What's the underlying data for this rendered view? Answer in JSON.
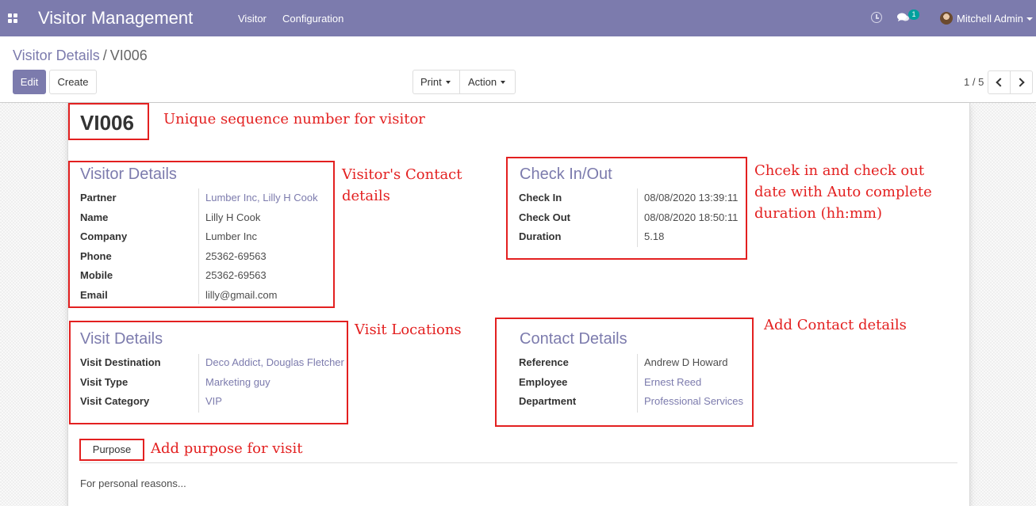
{
  "navbar": {
    "app_title": "Visitor Management",
    "menu": [
      "Visitor",
      "Configuration"
    ],
    "activity_icon": "clock-icon",
    "messages_icon": "chat-bubbles-icon",
    "messages_count": "1",
    "user_name": "Mitchell Admin"
  },
  "breadcrumb": {
    "parent": "Visitor Details",
    "separator": "/",
    "current": "VI006"
  },
  "toolbar": {
    "edit": "Edit",
    "create": "Create",
    "print": "Print",
    "action": "Action"
  },
  "pager": {
    "value": "1 / 5"
  },
  "record": {
    "name": "VI006"
  },
  "visitor_details": {
    "title": "Visitor Details",
    "fields": [
      {
        "label": "Partner",
        "value": "Lumber Inc, Lilly H Cook"
      },
      {
        "label": "Name",
        "value": "Lilly H Cook"
      },
      {
        "label": "Company",
        "value": "Lumber Inc"
      },
      {
        "label": "Phone",
        "value": "25362-69563"
      },
      {
        "label": "Mobile",
        "value": "25362-69563"
      },
      {
        "label": "Email",
        "value": "lilly@gmail.com"
      }
    ]
  },
  "check_in_out": {
    "title": "Check In/Out",
    "fields": [
      {
        "label": "Check In",
        "value": "08/08/2020 13:39:11"
      },
      {
        "label": "Check Out",
        "value": "08/08/2020 18:50:11"
      },
      {
        "label": "Duration",
        "value": "5.18"
      }
    ]
  },
  "visit_details": {
    "title": "Visit Details",
    "fields": [
      {
        "label": "Visit Destination",
        "value": "Deco Addict, Douglas Fletcher"
      },
      {
        "label": "Visit Type",
        "value": "Marketing guy"
      },
      {
        "label": "Visit Category",
        "value": "VIP"
      }
    ]
  },
  "contact_details": {
    "title": "Contact Details",
    "fields": [
      {
        "label": "Reference",
        "value": "Andrew D Howard"
      },
      {
        "label": "Employee",
        "value": "Ernest Reed"
      },
      {
        "label": "Department",
        "value": "Professional Services"
      }
    ]
  },
  "notebook": {
    "tab": "Purpose",
    "content": "For personal reasons..."
  },
  "annotations": {
    "sequence": "Unique sequence number for visitor",
    "contact": [
      "Visitor's Contact",
      "details"
    ],
    "checkinout": [
      "Chcek in and check out",
      "date with Auto complete",
      "duration (hh:mm)"
    ],
    "locations": "Visit Locations",
    "add_contact": "Add Contact details",
    "purpose": "Add purpose for visit"
  },
  "colors": {
    "navbar": "#7c7bad",
    "accent": "#7c7bad",
    "annotation": "#e32020"
  }
}
